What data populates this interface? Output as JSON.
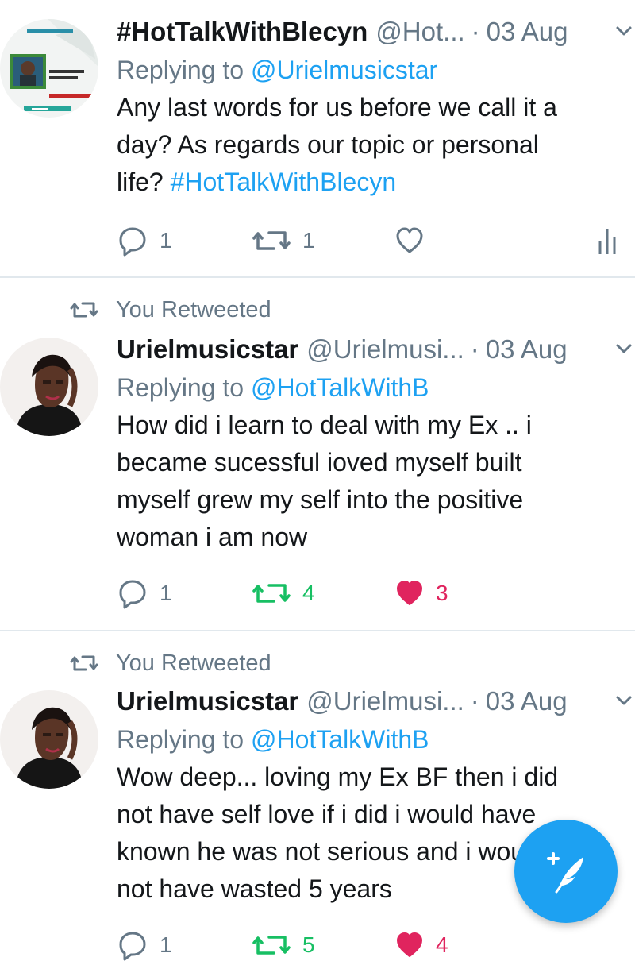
{
  "tweets": [
    {
      "retweeted_label": "",
      "name": "#HotTalkWithBlecyn",
      "handle": "@Hot...",
      "separator": "·",
      "time": "03 Aug",
      "reply_prefix": "Replying to ",
      "reply_to": "@Urielmusicstar",
      "text_line1": "Any last words for us before we call it a",
      "text_line2": "day? As regards our topic or personal",
      "text_line3": "life? ",
      "hashtag": "#HotTalkWithBlecyn",
      "replies": "1",
      "retweets": "1",
      "likes": "",
      "retweeted": false,
      "liked": false
    },
    {
      "retweeted_label": "You Retweeted",
      "name": "Urielmusicstar",
      "handle": "@Urielmusi...",
      "separator": "·",
      "time": "03 Aug",
      "reply_prefix": "Replying to ",
      "reply_to": "@HotTalkWithB",
      "text_line1": "How did i learn to deal with my Ex .. i",
      "text_line2": "became sucessful ioved myself built",
      "text_line3": "myself grew my self into the positive",
      "text_line4": "woman i am now",
      "replies": "1",
      "retweets": "4",
      "likes": "3",
      "retweeted": true,
      "liked": true
    },
    {
      "retweeted_label": "You Retweeted",
      "name": "Urielmusicstar",
      "handle": "@Urielmusi...",
      "separator": "·",
      "time": "03 Aug",
      "reply_prefix": "Replying to ",
      "reply_to": "@HotTalkWithB",
      "text_line1": "Wow deep... loving my Ex BF then i did",
      "text_line2": "not have self love if i did i would have",
      "text_line3": "known he was not serious and i would",
      "text_line4": "not have wasted 5 years",
      "replies": "1",
      "retweets": "5",
      "likes": "4",
      "retweeted": true,
      "liked": true
    }
  ],
  "colors": {
    "accent": "#1da1f2",
    "retweet_green": "#17bf63",
    "like_red": "#e0245e",
    "muted": "#657786",
    "divider": "#e1e8ed"
  },
  "icons": {
    "reply": "reply-icon",
    "retweet": "retweet-icon",
    "like": "heart-icon",
    "analytics": "analytics-icon",
    "caret": "chevron-down-icon",
    "compose": "compose-tweet-icon"
  }
}
